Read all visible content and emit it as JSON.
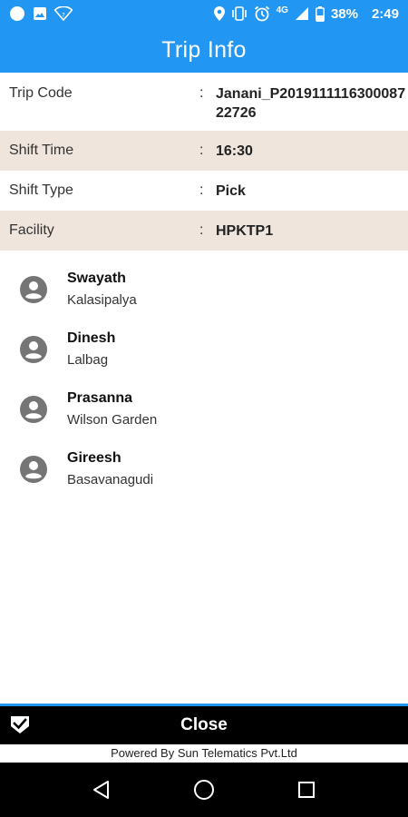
{
  "status_bar": {
    "network": "4G",
    "battery": "38%",
    "time": "2:49"
  },
  "header": {
    "title": "Trip Info"
  },
  "trip": {
    "rows": [
      {
        "label": "Trip Code",
        "colon": ":",
        "value": "Janani_P201911111630008722726"
      },
      {
        "label": "Shift Time",
        "colon": ":",
        "value": "16:30"
      },
      {
        "label": "Shift Type",
        "colon": ":",
        "value": "Pick"
      },
      {
        "label": "Facility",
        "colon": ":",
        "value": "HPKTP1"
      }
    ]
  },
  "passengers": [
    {
      "name": "Swayath",
      "area": "Kalasipalya"
    },
    {
      "name": "Dinesh",
      "area": "Lalbag"
    },
    {
      "name": "Prasanna",
      "area": "Wilson Garden"
    },
    {
      "name": "Gireesh",
      "area": "Basavanagudi"
    }
  ],
  "footer": {
    "close_label": "Close",
    "powered_by": "Powered By Sun Telematics Pvt.Ltd"
  },
  "colors": {
    "primary": "#2196f3",
    "shade_row": "#efe5dc",
    "avatar": "#757575"
  },
  "icons": {
    "status_left": [
      "circle-notification-icon",
      "image-icon",
      "wifi-icon"
    ],
    "status_right": [
      "location-icon",
      "vibrate-icon",
      "alarm-icon",
      "signal-icon",
      "battery-icon"
    ],
    "passenger": "account-circle-icon",
    "close": "checkbox-check-icon",
    "nav": [
      "back-icon",
      "home-icon",
      "recents-icon"
    ]
  }
}
